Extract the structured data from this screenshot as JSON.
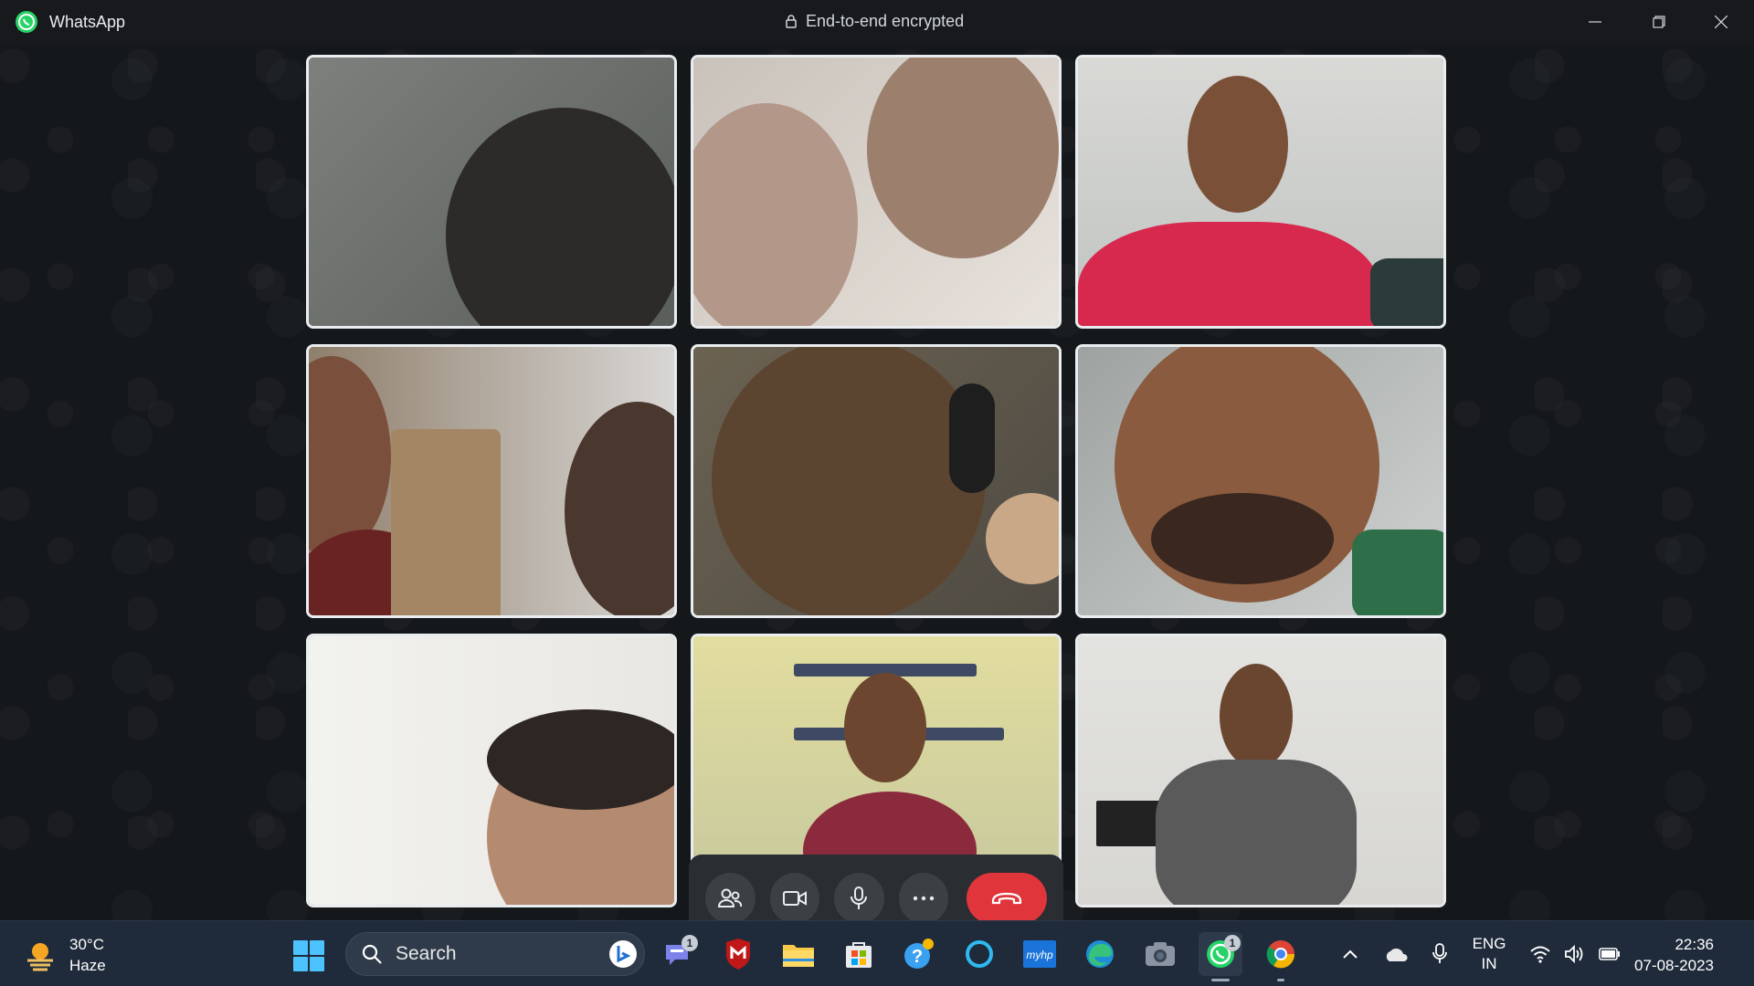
{
  "titlebar": {
    "app_name": "WhatsApp",
    "encryption_label": "End-to-end encrypted"
  },
  "call": {
    "participants": [
      {
        "label": "participant-1"
      },
      {
        "label": "participant-2"
      },
      {
        "label": "participant-3"
      },
      {
        "label": "participant-4"
      },
      {
        "label": "participant-5"
      },
      {
        "label": "participant-6"
      },
      {
        "label": "participant-7"
      },
      {
        "label": "participant-8"
      },
      {
        "label": "participant-9"
      }
    ],
    "controls": [
      "participants-icon",
      "video-camera-icon",
      "microphone-icon",
      "more-options-icon",
      "end-call-icon"
    ],
    "end_call_color": "#e0353b"
  },
  "taskbar": {
    "weather_temp": "30°C",
    "weather_desc": "Haze",
    "search_label": "Search",
    "teams_badge": "1",
    "whatsapp_badge": "1",
    "lang_line1": "ENG",
    "lang_line2": "IN",
    "time": "22:36",
    "date": "07-08-2023"
  }
}
